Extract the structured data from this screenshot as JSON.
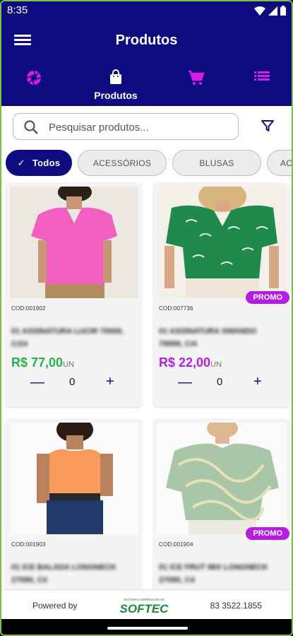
{
  "status_bar": {
    "time": "8:35"
  },
  "header": {
    "title": "Produtos"
  },
  "nav": {
    "products_label": "Produtos"
  },
  "search": {
    "placeholder": "Pesquisar produtos..."
  },
  "chips": [
    {
      "label": "Todos",
      "active": true
    },
    {
      "label": "ACESSÓRIOS"
    },
    {
      "label": "BLUSAS"
    },
    {
      "label": "AC"
    }
  ],
  "products": [
    {
      "code": "COD:001902",
      "name": "01 ASSINATURA LUCIR 70000, C/24",
      "price": "R$ 77,00",
      "unit": "UN",
      "qty": "0",
      "promo": false,
      "price_color": "#24b34a"
    },
    {
      "code": "COD:007736",
      "name": "01 ASSINATURA SWANDO 79999, C/4",
      "price": "R$ 22,00",
      "unit": "UN",
      "qty": "0",
      "promo": true,
      "promo_label": "PROMO",
      "price_color": "#b51ee0"
    },
    {
      "code": "COD:001903",
      "name": "01 ICE BALADA LONGNECK 27090, C4",
      "price": "",
      "unit": "",
      "qty": "",
      "promo": false
    },
    {
      "code": "COD:001904",
      "name": "01 ICE FRUT MIX LONGNECK 27090, C4",
      "price": "",
      "unit": "",
      "qty": "",
      "promo": true,
      "promo_label": "PROMO"
    }
  ],
  "footer": {
    "powered_by": "Powered by",
    "logo": "SOFTEC",
    "logo_tagline": "SISTEMAS EMPRESARIAIS",
    "phone": "83 3522.1855"
  },
  "colors": {
    "primary": "#0e0a80",
    "accent": "#b51ee0",
    "price_green": "#24b34a"
  }
}
